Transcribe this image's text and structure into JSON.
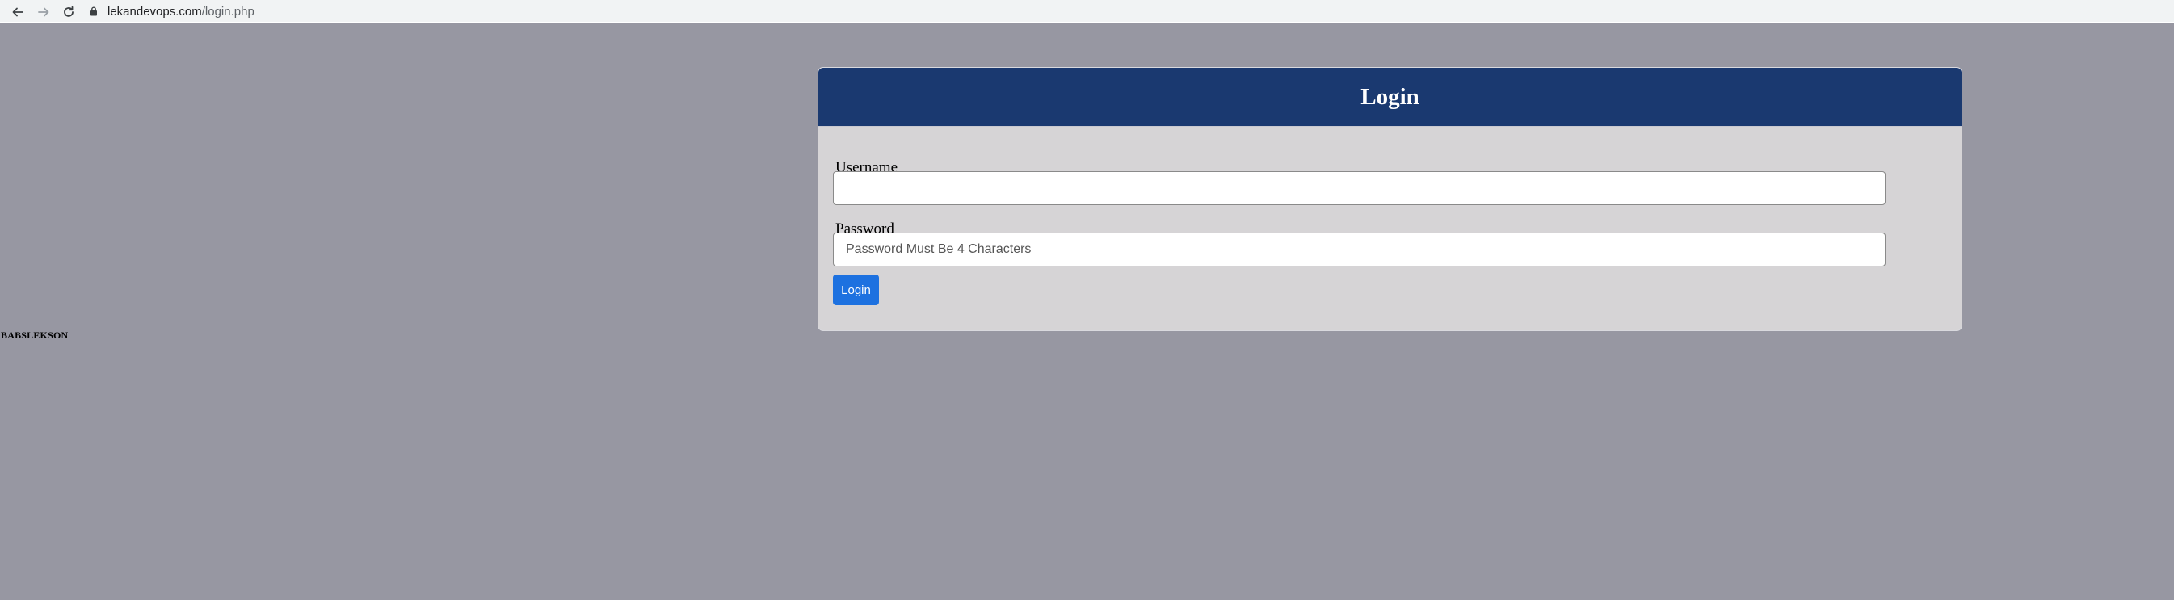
{
  "browser": {
    "url_host": "lekandevops.com",
    "url_path": "/login.php",
    "icons": {
      "back": "arrow-left-icon",
      "forward": "arrow-right-icon",
      "reload": "reload-icon",
      "lock": "lock-icon"
    }
  },
  "login": {
    "title": "Login",
    "username_label": "Username",
    "username_value": "",
    "password_label": "Password",
    "password_placeholder": "Password Must Be 4 Characters",
    "submit_label": "Login"
  },
  "footer": {
    "text": "BABSLEKSON"
  },
  "colors": {
    "page_background": "#9797a2",
    "header_background": "#1a3970",
    "card_background": "#d6d4d6",
    "button_background": "#1d71e0"
  }
}
